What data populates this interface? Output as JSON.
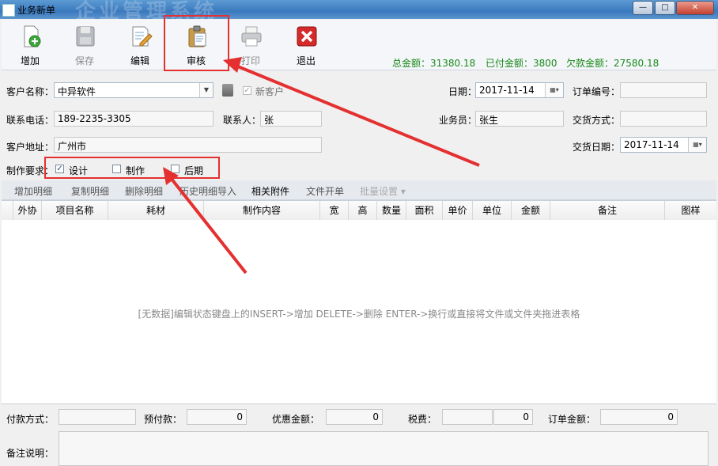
{
  "window": {
    "title": "业务新单",
    "watermark": "企业管理系统",
    "buttons": {
      "min": "—",
      "max": "□",
      "close": "✕"
    }
  },
  "toolbar": {
    "add": "增加",
    "save": "保存",
    "edit": "编辑",
    "audit": "审核",
    "print": "打印",
    "exit": "退出"
  },
  "summary": {
    "total": "总金额：31380.18",
    "paid": "已付金额：3800",
    "owed": "欠款金额：27580.18"
  },
  "form": {
    "customer_label": "客户名称：",
    "customer": "中异软件",
    "new_customer_label": "新客户",
    "date_label": "日期：",
    "date": "2017-11-14",
    "order_no_label": "订单编号：",
    "order_no": "",
    "phone_label": "联系电话：",
    "phone": "189-2235-3305",
    "contact_label": "联系人：",
    "contact": "张",
    "salesman_label": "业务员：",
    "salesman": "张生",
    "delivery_method_label": "交货方式：",
    "delivery_method": "",
    "address_label": "客户地址：",
    "address": "广州市",
    "delivery_date_label": "交货日期：",
    "delivery_date": "2017-11-14",
    "req_label": "制作要求：",
    "req_design": "设计",
    "req_make": "制作",
    "req_post": "后期"
  },
  "detail_toolbar": {
    "add": "增加明细",
    "copy": "复制明细",
    "delete": "删除明细",
    "history": "历史明细导入",
    "attach": "相关附件",
    "file_bill": "文件开单",
    "batch": "批量设置 ▾"
  },
  "columns": [
    "外协",
    "项目名称",
    "耗材",
    "制作内容",
    "宽",
    "高",
    "数量",
    "面积",
    "单价",
    "单位",
    "金额",
    "备注",
    "图样"
  ],
  "empty_text": "[无数据]编辑状态键盘上的INSERT->增加 DELETE->删除 ENTER->换行或直接将文件或文件夹拖进表格",
  "bottom": {
    "payment_label": "付款方式：",
    "payment": "",
    "prepay_label": "预付款：",
    "prepay": "0",
    "discount_label": "优惠金额：",
    "discount": "0",
    "tax_label": "税费：",
    "tax": "0",
    "order_amount_label": "订单金额：",
    "order_amount": "0",
    "remark_label": "备注说明：",
    "remark": ""
  },
  "colors": {
    "highlight": "#e43030",
    "summary": "#1a8a1a"
  }
}
